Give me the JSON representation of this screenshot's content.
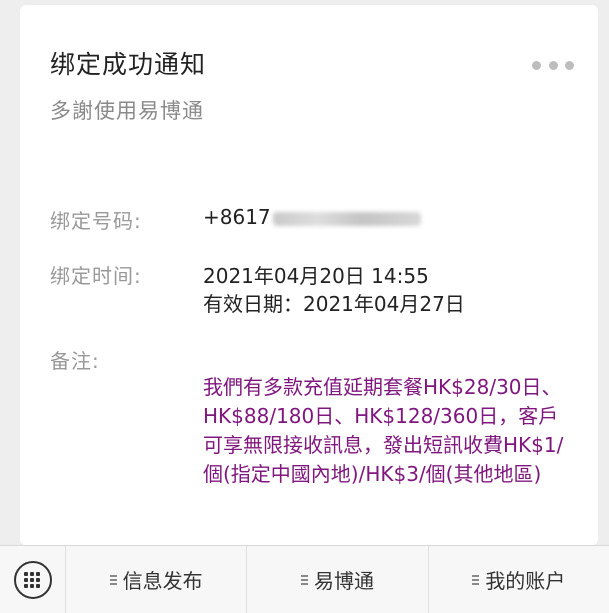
{
  "card": {
    "title": "绑定成功通知",
    "subtitle": "多謝使用易博通",
    "rows": [
      {
        "label": "绑定号码:",
        "value": "+8617"
      },
      {
        "label": "绑定时间:",
        "value": "2021年04月20日 14:55",
        "value2": "有效日期：2021年04月27日"
      },
      {
        "label": "备注:"
      }
    ],
    "note": "我們有多款充值延期套餐HK$28/30日、HK$88/180日、HK$128/360日，客戶可享無限接收訊息，發出短訊收費HK$1/個(指定中國內地)/HK$3/個(其他地區)"
  },
  "bottom_menu": [
    {
      "label": "信息发布"
    },
    {
      "label": "易博通"
    },
    {
      "label": "我的账户"
    }
  ],
  "colors": {
    "note": "#80177f",
    "label": "#999999",
    "text": "#222222"
  },
  "icons": {
    "more": "more-dots-icon",
    "keyboard": "keyboard-icon",
    "menu": "menu-list-icon"
  }
}
